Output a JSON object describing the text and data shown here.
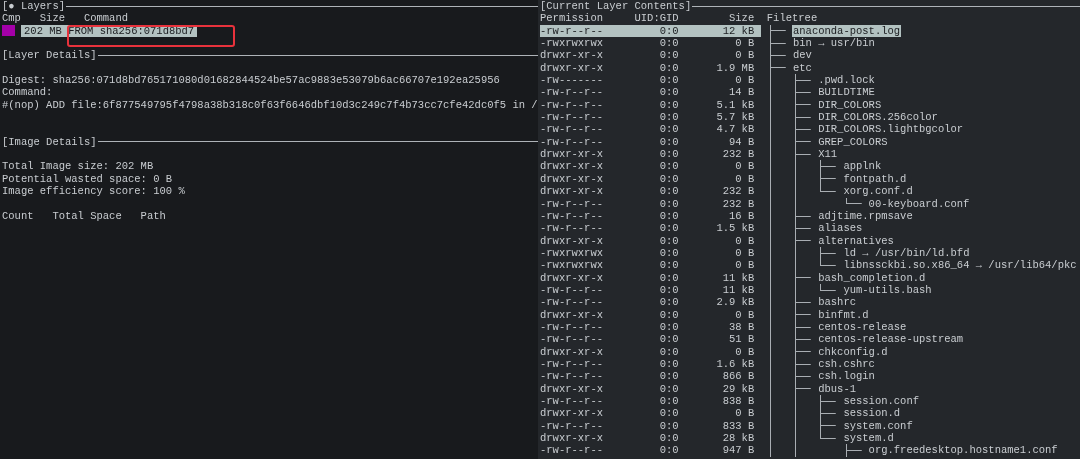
{
  "layers": {
    "title": "[● Layers]",
    "columns": [
      "Cmp",
      "Size",
      "Command"
    ],
    "rows": [
      {
        "size": "202 MB",
        "command": "FROM sha256:071d8bd7",
        "selected": true
      }
    ]
  },
  "layer_details": {
    "title": "[Layer Details]",
    "digest": "Digest: sha256:071d8bd765171080d01682844524be57ac9883e53079b6ac66707e192ea25956",
    "command_label": "Command:",
    "command": "#(nop) ADD file:6f877549795f4798a38b318c0f63f6646dbf10d3c249c7f4b73cc7cfe42dc0f5 in /"
  },
  "image_details": {
    "title": "[Image Details]",
    "lines": [
      "Total Image size: 202 MB",
      "Potential wasted space: 0 B",
      "Image efficiency score: 100 %"
    ],
    "columns": [
      "Count",
      "Total Space",
      "Path"
    ]
  },
  "contents": {
    "title": "[Current Layer Contents]",
    "columns": [
      "Permission",
      "UID:GID",
      "Size",
      "Filetree"
    ],
    "continues": true,
    "items": [
      {
        "permission": "-rw-r--r--",
        "uid_gid": "0:0",
        "size": "12 kB",
        "name": "anaconda-post.log",
        "selected": true
      },
      {
        "permission": "-rwxrwxrwx",
        "uid_gid": "0:0",
        "size": "0 B",
        "name": "bin → usr/bin",
        "selected": false
      },
      {
        "permission": "drwxr-xr-x",
        "uid_gid": "0:0",
        "size": "0 B",
        "name": "dev",
        "selected": false
      },
      {
        "permission": "drwxr-xr-x",
        "uid_gid": "0:0",
        "size": "1.9 MB",
        "name": "etc",
        "selected": false,
        "continues": true,
        "children": [
          {
            "permission": "-rw-------",
            "uid_gid": "0:0",
            "size": "0 B",
            "name": ".pwd.lock",
            "selected": false
          },
          {
            "permission": "-rw-r--r--",
            "uid_gid": "0:0",
            "size": "14 B",
            "name": "BUILDTIME",
            "selected": false
          },
          {
            "permission": "-rw-r--r--",
            "uid_gid": "0:0",
            "size": "5.1 kB",
            "name": "DIR_COLORS",
            "selected": false
          },
          {
            "permission": "-rw-r--r--",
            "uid_gid": "0:0",
            "size": "5.7 kB",
            "name": "DIR_COLORS.256color",
            "selected": false
          },
          {
            "permission": "-rw-r--r--",
            "uid_gid": "0:0",
            "size": "4.7 kB",
            "name": "DIR_COLORS.lightbgcolor",
            "selected": false
          },
          {
            "permission": "-rw-r--r--",
            "uid_gid": "0:0",
            "size": "94 B",
            "name": "GREP_COLORS",
            "selected": false
          },
          {
            "permission": "drwxr-xr-x",
            "uid_gid": "0:0",
            "size": "232 B",
            "name": "X11",
            "selected": false,
            "children": [
              {
                "permission": "drwxr-xr-x",
                "uid_gid": "0:0",
                "size": "0 B",
                "name": "applnk",
                "selected": false
              },
              {
                "permission": "drwxr-xr-x",
                "uid_gid": "0:0",
                "size": "0 B",
                "name": "fontpath.d",
                "selected": false
              },
              {
                "permission": "drwxr-xr-x",
                "uid_gid": "0:0",
                "size": "232 B",
                "name": "xorg.conf.d",
                "selected": false,
                "children": [
                  {
                    "permission": "-rw-r--r--",
                    "uid_gid": "0:0",
                    "size": "232 B",
                    "name": "00-keyboard.conf",
                    "selected": false
                  }
                ]
              }
            ]
          },
          {
            "permission": "-rw-r--r--",
            "uid_gid": "0:0",
            "size": "16 B",
            "name": "adjtime.rpmsave",
            "selected": false
          },
          {
            "permission": "-rw-r--r--",
            "uid_gid": "0:0",
            "size": "1.5 kB",
            "name": "aliases",
            "selected": false
          },
          {
            "permission": "drwxr-xr-x",
            "uid_gid": "0:0",
            "size": "0 B",
            "name": "alternatives",
            "selected": false,
            "children": [
              {
                "permission": "-rwxrwxrwx",
                "uid_gid": "0:0",
                "size": "0 B",
                "name": "ld → /usr/bin/ld.bfd",
                "selected": false
              },
              {
                "permission": "-rwxrwxrwx",
                "uid_gid": "0:0",
                "size": "0 B",
                "name": "libnssckbi.so.x86_64 → /usr/lib64/pkc",
                "selected": false
              }
            ]
          },
          {
            "permission": "drwxr-xr-x",
            "uid_gid": "0:0",
            "size": "11 kB",
            "name": "bash_completion.d",
            "selected": false,
            "children": [
              {
                "permission": "-rw-r--r--",
                "uid_gid": "0:0",
                "size": "11 kB",
                "name": "yum-utils.bash",
                "selected": false
              }
            ]
          },
          {
            "permission": "-rw-r--r--",
            "uid_gid": "0:0",
            "size": "2.9 kB",
            "name": "bashrc",
            "selected": false
          },
          {
            "permission": "drwxr-xr-x",
            "uid_gid": "0:0",
            "size": "0 B",
            "name": "binfmt.d",
            "selected": false
          },
          {
            "permission": "-rw-r--r--",
            "uid_gid": "0:0",
            "size": "38 B",
            "name": "centos-release",
            "selected": false
          },
          {
            "permission": "-rw-r--r--",
            "uid_gid": "0:0",
            "size": "51 B",
            "name": "centos-release-upstream",
            "selected": false
          },
          {
            "permission": "drwxr-xr-x",
            "uid_gid": "0:0",
            "size": "0 B",
            "name": "chkconfig.d",
            "selected": false
          },
          {
            "permission": "-rw-r--r--",
            "uid_gid": "0:0",
            "size": "1.6 kB",
            "name": "csh.cshrc",
            "selected": false
          },
          {
            "permission": "-rw-r--r--",
            "uid_gid": "0:0",
            "size": "866 B",
            "name": "csh.login",
            "selected": false
          },
          {
            "permission": "drwxr-xr-x",
            "uid_gid": "0:0",
            "size": "29 kB",
            "name": "dbus-1",
            "selected": false,
            "children": [
              {
                "permission": "-rw-r--r--",
                "uid_gid": "0:0",
                "size": "838 B",
                "name": "session.conf",
                "selected": false
              },
              {
                "permission": "drwxr-xr-x",
                "uid_gid": "0:0",
                "size": "0 B",
                "name": "session.d",
                "selected": false
              },
              {
                "permission": "-rw-r--r--",
                "uid_gid": "0:0",
                "size": "833 B",
                "name": "system.conf",
                "selected": false
              },
              {
                "permission": "drwxr-xr-x",
                "uid_gid": "0:0",
                "size": "28 kB",
                "name": "system.d",
                "selected": false,
                "continues": true,
                "children": [
                  {
                    "permission": "-rw-r--r--",
                    "uid_gid": "0:0",
                    "size": "947 B",
                    "name": "org.freedesktop.hostname1.conf",
                    "selected": false
                  }
                ]
              }
            ]
          }
        ]
      }
    ]
  }
}
